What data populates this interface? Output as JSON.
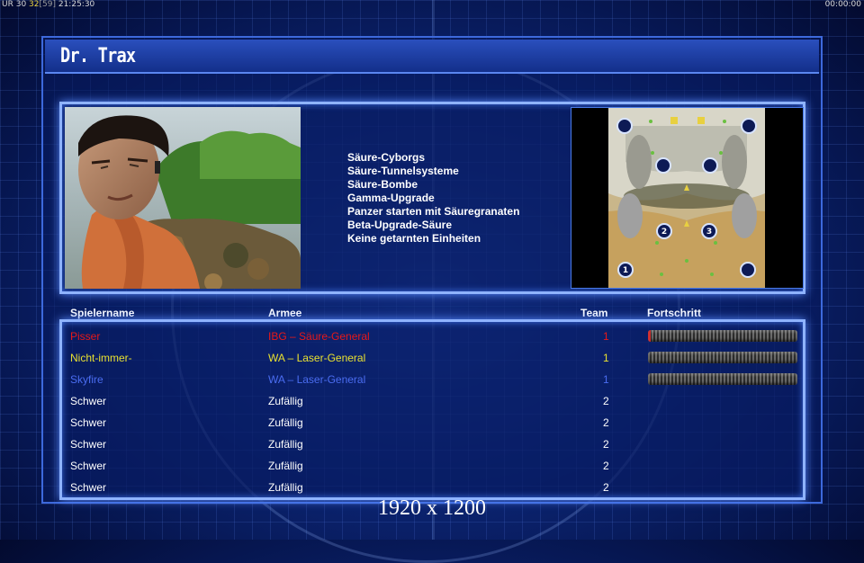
{
  "hud": {
    "left_a": "UR",
    "left_b": "30",
    "left_c": "32",
    "left_d": "[59]",
    "left_time": "21:25:30",
    "right_time": "00:00:00"
  },
  "general": {
    "name": "Dr. Trax"
  },
  "perks": [
    "Säure-Cyborgs",
    "Säure-Tunnelsysteme",
    "Säure-Bombe",
    "Gamma-Upgrade",
    "Panzer starten mit Säuregranaten",
    "Beta-Upgrade-Säure",
    "Keine getarnten Einheiten"
  ],
  "table": {
    "headers": {
      "player": "Spielername",
      "army": "Armee",
      "team": "Team",
      "progress": "Fortschritt"
    },
    "rows": [
      {
        "name": "Pisser",
        "army": "IBG – Säure-General",
        "team": "1",
        "color": "#e81818",
        "progress": 0.02
      },
      {
        "name": "Nicht-immer-",
        "army": "WA – Laser-General",
        "team": "1",
        "color": "#e8e030",
        "progress": 0
      },
      {
        "name": "Skyfire",
        "army": "WA – Laser-General",
        "team": "1",
        "color": "#4a6cf0",
        "progress": 0
      },
      {
        "name": "Schwer",
        "army": "Zufällig",
        "team": "2",
        "color": "#ffffff"
      },
      {
        "name": "Schwer",
        "army": "Zufällig",
        "team": "2",
        "color": "#ffffff"
      },
      {
        "name": "Schwer",
        "army": "Zufällig",
        "team": "2",
        "color": "#ffffff"
      },
      {
        "name": "Schwer",
        "army": "Zufällig",
        "team": "2",
        "color": "#ffffff"
      },
      {
        "name": "Schwer",
        "army": "Zufällig",
        "team": "2",
        "color": "#ffffff"
      }
    ]
  },
  "minimap": {
    "spawn_labels": [
      "1",
      "2",
      "3"
    ]
  },
  "resolution": "1920 x 1200"
}
